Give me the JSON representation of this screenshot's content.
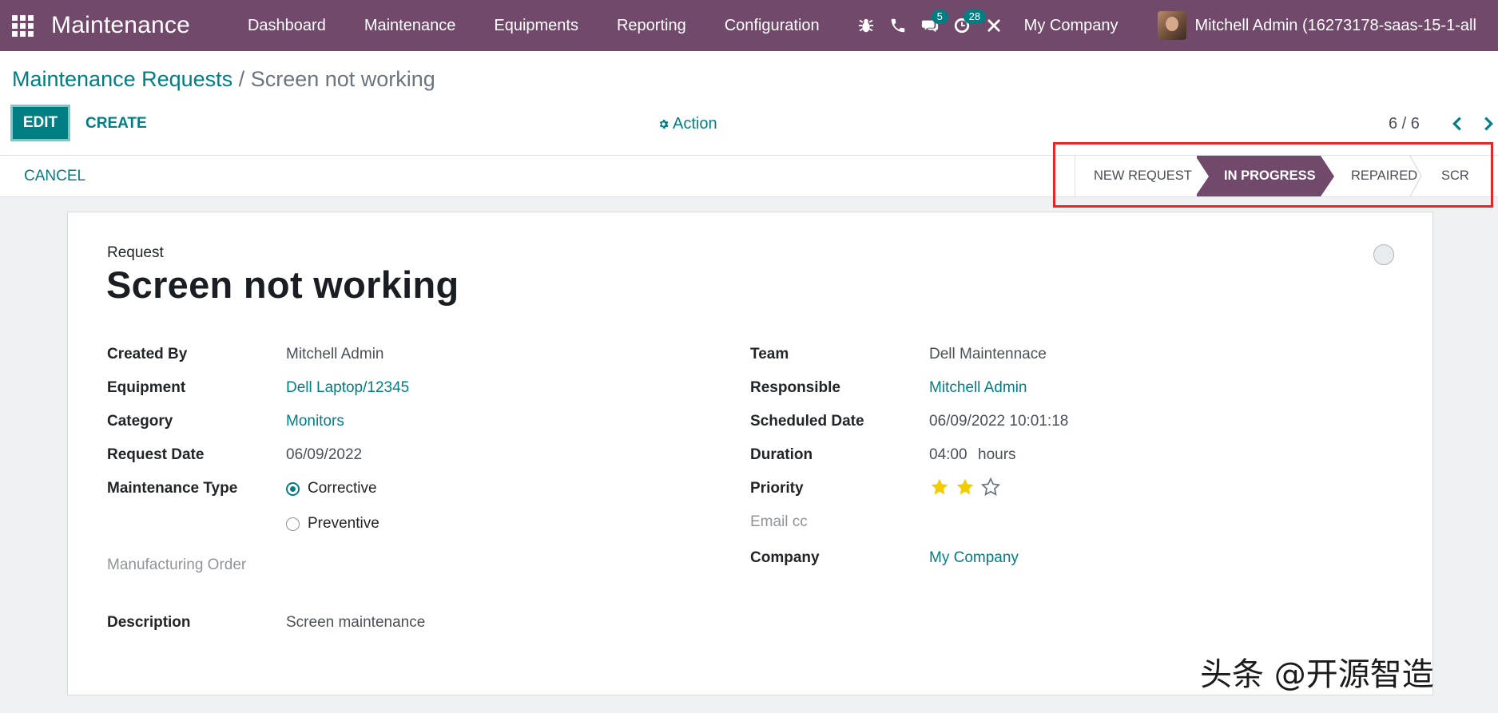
{
  "navbar": {
    "brand": "Maintenance",
    "menu": [
      "Dashboard",
      "Maintenance",
      "Equipments",
      "Reporting",
      "Configuration"
    ],
    "chat_badge": "5",
    "activity_badge": "28",
    "company": "My Company",
    "user": "Mitchell Admin (16273178-saas-15-1-all"
  },
  "breadcrumb": {
    "parent": "Maintenance Requests",
    "separator": " / ",
    "current": "Screen not working"
  },
  "toolbar": {
    "edit_label": "EDIT",
    "create_label": "CREATE",
    "action_label": "Action",
    "pager": "6 / 6"
  },
  "statusbar": {
    "cancel_label": "CANCEL",
    "stages": [
      "NEW REQUEST",
      "IN PROGRESS",
      "REPAIRED",
      "SCRAP"
    ],
    "active_stage": "IN PROGRESS"
  },
  "form": {
    "request_label": "Request",
    "title": "Screen not working",
    "left": {
      "created_by_label": "Created By",
      "created_by": "Mitchell Admin",
      "equipment_label": "Equipment",
      "equipment": "Dell Laptop/12345",
      "category_label": "Category",
      "category": "Monitors",
      "request_date_label": "Request Date",
      "request_date": "06/09/2022",
      "maintenance_type_label": "Maintenance Type",
      "maintenance_type_options": [
        "Corrective",
        "Preventive"
      ],
      "maintenance_type_selected": "Corrective",
      "manufacturing_order_label": "Manufacturing Order",
      "description_label": "Description",
      "description": "Screen maintenance"
    },
    "right": {
      "team_label": "Team",
      "team": "Dell Maintennace",
      "responsible_label": "Responsible",
      "responsible": "Mitchell Admin",
      "scheduled_date_label": "Scheduled Date",
      "scheduled_date": "06/09/2022 10:01:18",
      "duration_label": "Duration",
      "duration": "04:00",
      "duration_unit": "hours",
      "priority_label": "Priority",
      "priority": 2,
      "priority_max": 3,
      "email_cc_label": "Email cc",
      "company_label": "Company",
      "company": "My Company"
    }
  },
  "colors": {
    "navbar": "#71496a",
    "accent": "#017e84",
    "star": "#f3cc00",
    "highlight": "#e02a2a"
  },
  "watermark": "头条 @开源智造"
}
